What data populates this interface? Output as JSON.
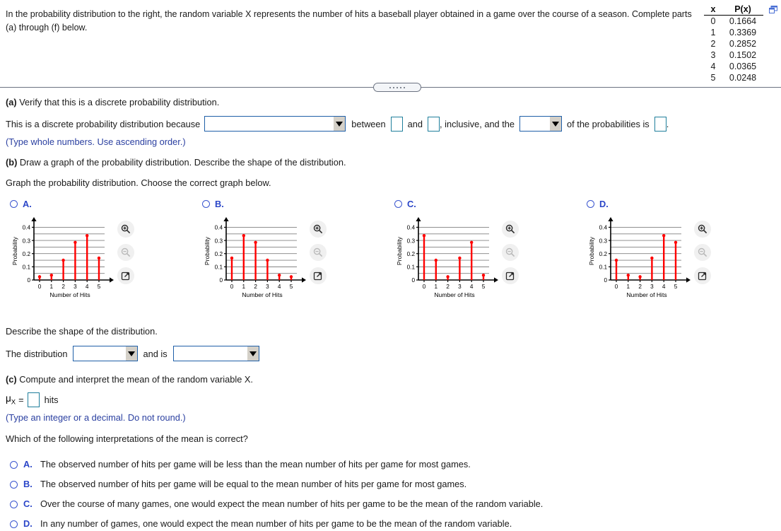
{
  "header": {
    "stem": "In the probability distribution to the right, the random variable X represents the number of hits a baseball player obtained in a game over the course of a season. Complete parts (a) through (f) below.",
    "popout_icon": "open-in-new-window-icon"
  },
  "prob_table": {
    "col_x": "x",
    "col_px": "P(x)",
    "rows": [
      {
        "x": "0",
        "px": "0.1664"
      },
      {
        "x": "1",
        "px": "0.3369"
      },
      {
        "x": "2",
        "px": "0.2852"
      },
      {
        "x": "3",
        "px": "0.1502"
      },
      {
        "x": "4",
        "px": "0.0365"
      },
      {
        "x": "5",
        "px": "0.0248"
      }
    ]
  },
  "part_a": {
    "prompt_label": "(a)",
    "prompt_text": " Verify that this is a discrete probability distribution.",
    "sentence_start": "This is a discrete probability distribution because",
    "reason_dropdown_value": "",
    "between_text": "between",
    "lower_value": "",
    "and_text": "and",
    "upper_value": "",
    "inclusive_text": ", inclusive, and the",
    "sum_dropdown_value": "",
    "of_probabilities_text": "of the probabilities is",
    "total_value": "",
    "period": ".",
    "hint": "(Type whole numbers. Use ascending order.)"
  },
  "part_b": {
    "prompt_label": "(b)",
    "prompt_text": " Draw a graph of the probability distribution. Describe the shape of the distribution.",
    "instruction": "Graph the probability distribution. Choose the correct graph below.",
    "describe_prompt": "Describe the shape of the distribution.",
    "distribution_label": "The distribution",
    "shape_dropdown_value": "",
    "and_is_text": "and is",
    "skew_dropdown_value": ""
  },
  "part_c": {
    "prompt_label": "(c)",
    "prompt_text": " Compute and interpret the mean of the random variable X.",
    "mu_symbol": "μ",
    "mu_subscript": "X",
    "equals": "=",
    "mu_value": "",
    "units": "hits",
    "hint": "(Type an integer or a decimal. Do not round.)",
    "question": "Which of the following interpretations of the mean is correct?",
    "options": [
      {
        "letter": "A.",
        "text": "The observed number of hits per game will be less than the mean number of hits per game for most games."
      },
      {
        "letter": "B.",
        "text": "The observed number of hits per game will be equal to the mean number of hits per game for most games."
      },
      {
        "letter": "C.",
        "text": "Over the course of many games, one would expect the mean number of hits per game to be the mean of the random variable."
      },
      {
        "letter": "D.",
        "text": "In any number of games, one would expect the mean number of hits per game to be the mean of the random variable."
      }
    ]
  },
  "graph_icons": {
    "zoom_in": "zoom-in-icon",
    "zoom_out": "zoom-out-icon",
    "expand": "open-in-new-window-icon"
  },
  "colors": {
    "stem": "#FF0000",
    "marker": "#FF0000",
    "axis": "#000000",
    "grid": "#808080",
    "input_border": "#1f5fa8",
    "blue_text": "#2b46c8"
  },
  "chart_data": [
    {
      "id": "A",
      "label": "A.",
      "type": "scatter",
      "title": "",
      "xlabel": "Number of Hits",
      "ylabel": "Probability",
      "categories": [
        "0",
        "1",
        "2",
        "3",
        "4",
        "5"
      ],
      "values": [
        0.0248,
        0.0365,
        0.1502,
        0.2852,
        0.3369,
        0.1664
      ],
      "xtick_labels": [
        "0",
        "1",
        "2",
        "3",
        "4",
        "5"
      ],
      "ytick_labels": [
        "0",
        "0.1",
        "0.2",
        "0.3",
        "0.4"
      ],
      "ytick_values": [
        0,
        0.1,
        0.2,
        0.3,
        0.4
      ],
      "gridlines": [
        0.05,
        0.1,
        0.15,
        0.2,
        0.25,
        0.3,
        0.35,
        0.4
      ],
      "ylim": [
        0,
        0.44
      ],
      "grid": true,
      "legend": "none"
    },
    {
      "id": "B",
      "label": "B.",
      "type": "scatter",
      "title": "",
      "xlabel": "Number of Hits",
      "ylabel": "Probability",
      "categories": [
        "0",
        "1",
        "2",
        "3",
        "4",
        "5"
      ],
      "values": [
        0.1664,
        0.3369,
        0.2852,
        0.1502,
        0.0365,
        0.0248
      ],
      "xtick_labels": [
        "0",
        "1",
        "2",
        "3",
        "4",
        "5"
      ],
      "ytick_labels": [
        "0",
        "0.1",
        "0.2",
        "0.3",
        "0.4"
      ],
      "ytick_values": [
        0,
        0.1,
        0.2,
        0.3,
        0.4
      ],
      "gridlines": [
        0.05,
        0.1,
        0.15,
        0.2,
        0.25,
        0.3,
        0.35,
        0.4
      ],
      "ylim": [
        0,
        0.44
      ],
      "grid": true,
      "legend": "none"
    },
    {
      "id": "C",
      "label": "C.",
      "type": "scatter",
      "title": "",
      "xlabel": "Number of Hits",
      "ylabel": "Probability",
      "categories": [
        "0",
        "1",
        "2",
        "3",
        "4",
        "5"
      ],
      "values": [
        0.3369,
        0.1502,
        0.0248,
        0.1664,
        0.2852,
        0.0365
      ],
      "xtick_labels": [
        "0",
        "1",
        "2",
        "3",
        "4",
        "5"
      ],
      "ytick_labels": [
        "0",
        "0.1",
        "0.2",
        "0.3",
        "0.4"
      ],
      "ytick_values": [
        0,
        0.1,
        0.2,
        0.3,
        0.4
      ],
      "gridlines": [
        0.05,
        0.1,
        0.15,
        0.2,
        0.25,
        0.3,
        0.35,
        0.4
      ],
      "ylim": [
        0,
        0.44
      ],
      "grid": true,
      "legend": "none"
    },
    {
      "id": "D",
      "label": "D.",
      "type": "scatter",
      "title": "",
      "xlabel": "Number of Hits",
      "ylabel": "Probability",
      "categories": [
        "0",
        "1",
        "2",
        "3",
        "4",
        "5"
      ],
      "values": [
        0.1502,
        0.0365,
        0.0248,
        0.1664,
        0.3369,
        0.2852
      ],
      "xtick_labels": [
        "0",
        "1",
        "2",
        "3",
        "4",
        "5"
      ],
      "ytick_labels": [
        "0",
        "0.1",
        "0.2",
        "0.3",
        "0.4"
      ],
      "ytick_values": [
        0,
        0.1,
        0.2,
        0.3,
        0.4
      ],
      "gridlines": [
        0.05,
        0.1,
        0.15,
        0.2,
        0.25,
        0.3,
        0.35,
        0.4
      ],
      "ylim": [
        0,
        0.44
      ],
      "grid": true,
      "legend": "none"
    }
  ]
}
